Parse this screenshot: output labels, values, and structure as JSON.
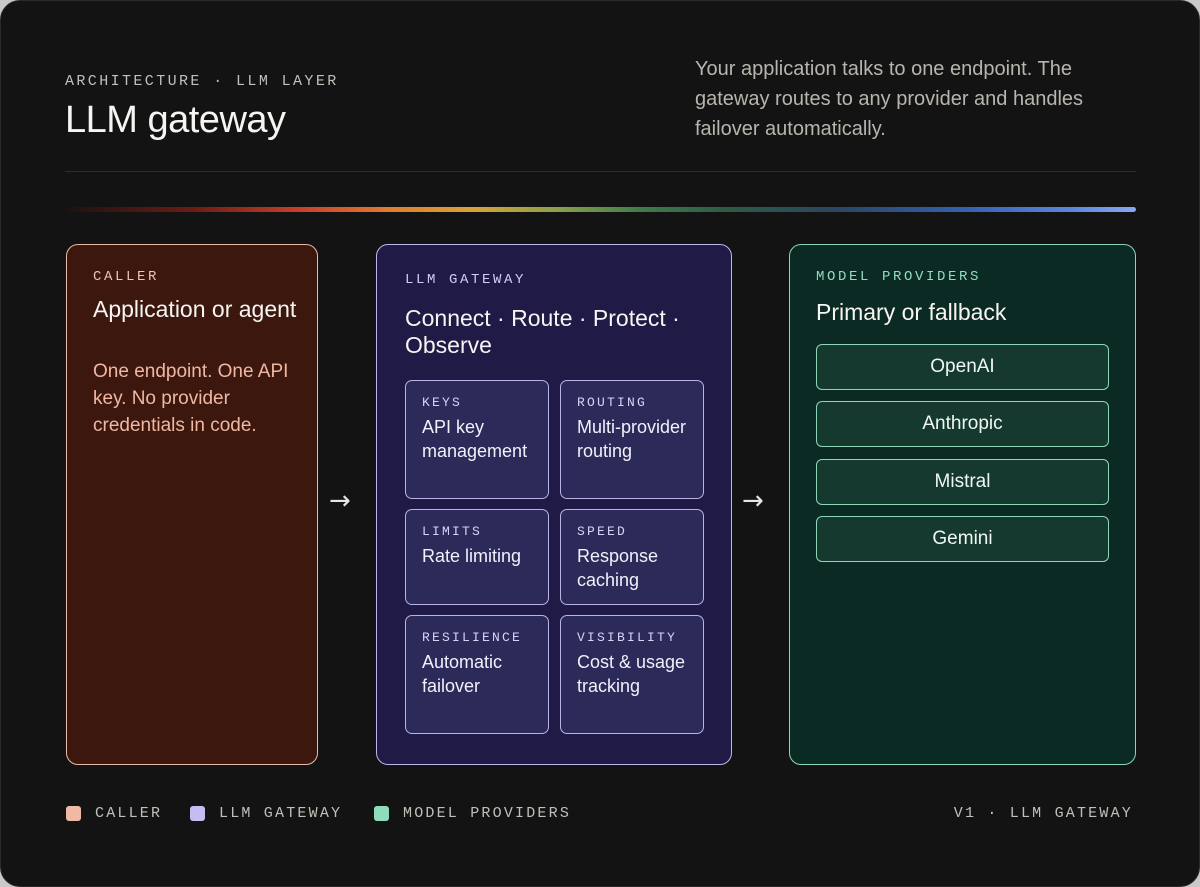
{
  "header": {
    "eyebrow": "ARCHITECTURE · LLM LAYER",
    "title": "LLM gateway",
    "intro": "Your application talks to one endpoint. The gateway routes to any provider and handles failover automatically."
  },
  "caller": {
    "eyebrow": "CALLER",
    "heading": "Application or agent",
    "body": "One endpoint. One API key. No provider credentials in code."
  },
  "gateway": {
    "eyebrow": "LLM GATEWAY",
    "heading": "Connect · Route · Protect · Observe",
    "cells": [
      {
        "eyebrow": "KEYS",
        "text": "API key management"
      },
      {
        "eyebrow": "ROUTING",
        "text": "Multi-provider routing"
      },
      {
        "eyebrow": "LIMITS",
        "text": "Rate limiting"
      },
      {
        "eyebrow": "SPEED",
        "text": "Response caching"
      },
      {
        "eyebrow": "RESILIENCE",
        "text": "Automatic failover"
      },
      {
        "eyebrow": "VISIBILITY",
        "text": "Cost & usage tracking"
      }
    ]
  },
  "providers": {
    "eyebrow": "MODEL PROVIDERS",
    "heading": "Primary or fallback",
    "items": [
      "OpenAI",
      "Anthropic",
      "Mistral",
      "Gemini"
    ]
  },
  "arrows": [
    "→",
    "→"
  ],
  "legend": [
    {
      "label": "CALLER",
      "color": "#f0b9a6"
    },
    {
      "label": "LLM GATEWAY",
      "color": "#c4bdf2"
    },
    {
      "label": "MODEL PROVIDERS",
      "color": "#8fdcbd"
    }
  ],
  "footer": {
    "version": "V1 · LLM GATEWAY"
  },
  "colors": {
    "background": "#141313",
    "caller_fill": "#3b170e",
    "caller_accent": "#f0b9a6",
    "gateway_fill": "#201a47",
    "gateway_accent": "#c4bdf2",
    "providers_fill": "#0b2a23",
    "providers_accent": "#8fdcbd"
  }
}
